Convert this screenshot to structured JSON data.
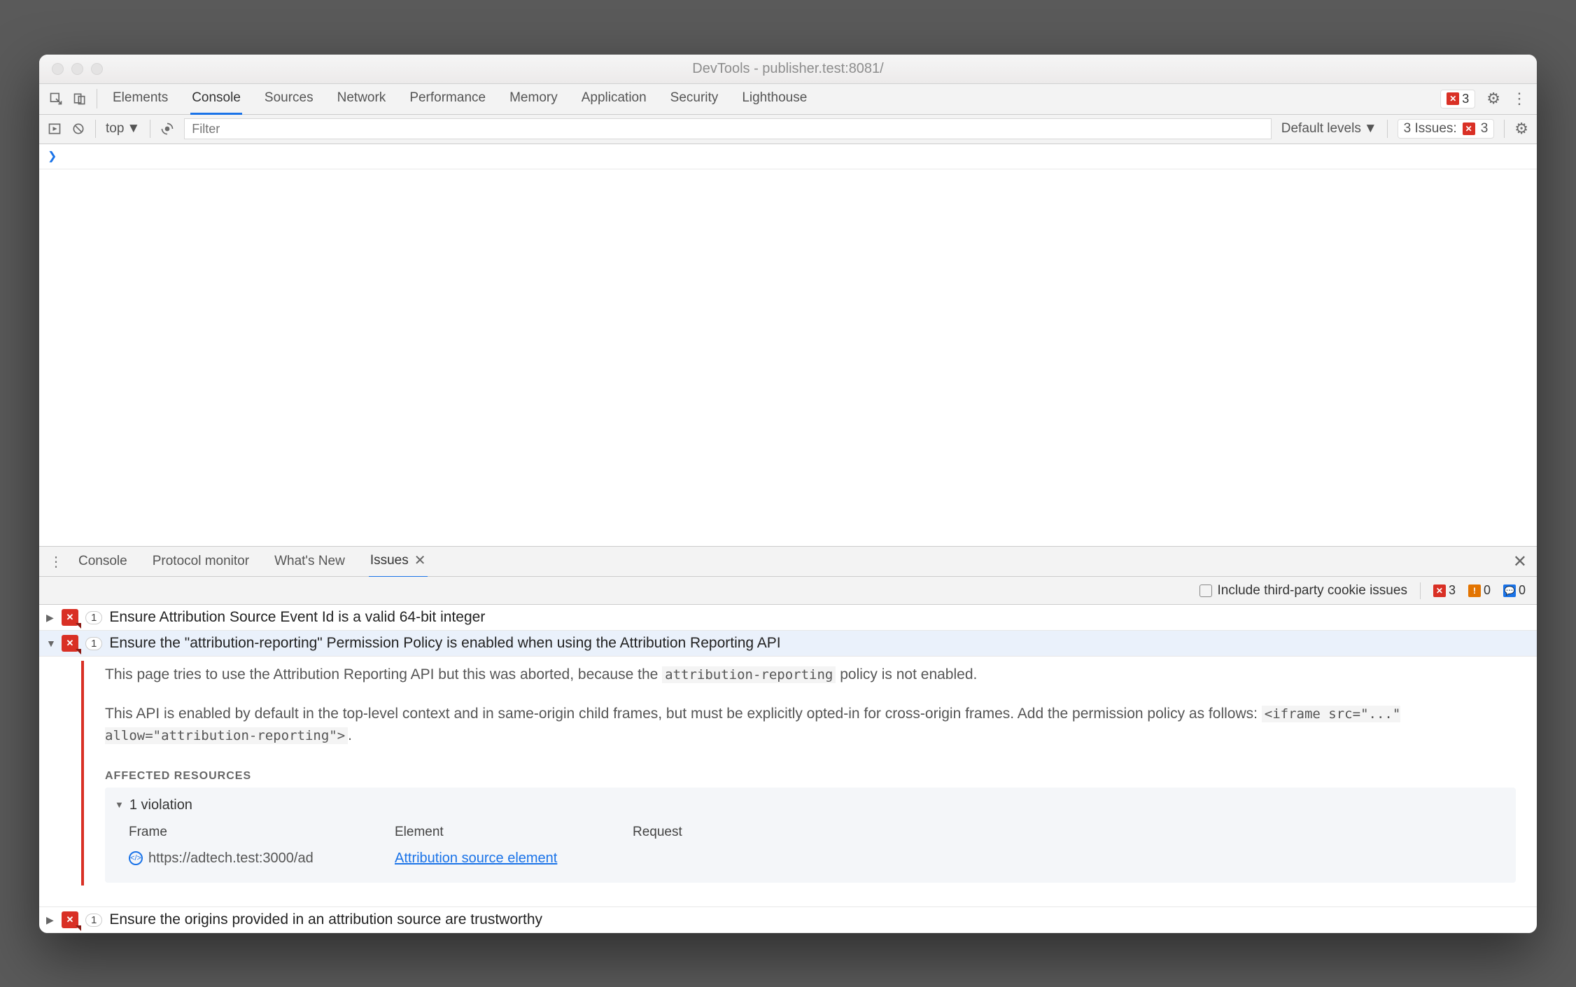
{
  "window": {
    "title": "DevTools - publisher.test:8081/"
  },
  "header_error_count": "3",
  "main_tabs": [
    "Elements",
    "Console",
    "Sources",
    "Network",
    "Performance",
    "Memory",
    "Application",
    "Security",
    "Lighthouse"
  ],
  "main_tabs_active": 1,
  "toolbar": {
    "context": "top",
    "filter_placeholder": "Filter",
    "levels": "Default levels",
    "issues_label": "3 Issues:",
    "issues_count": "3"
  },
  "drawer_tabs": [
    {
      "label": "Console"
    },
    {
      "label": "Protocol monitor"
    },
    {
      "label": "What's New"
    },
    {
      "label": "Issues",
      "active": true,
      "closable": true
    }
  ],
  "issues_filter": {
    "checkbox_label": "Include third-party cookie issues",
    "counts": {
      "error": "3",
      "warning": "0",
      "info": "0"
    }
  },
  "issues": [
    {
      "expanded": false,
      "count": "1",
      "title": "Ensure Attribution Source Event Id is a valid 64-bit integer"
    },
    {
      "expanded": true,
      "count": "1",
      "title": "Ensure the \"attribution-reporting\" Permission Policy is enabled when using the Attribution Reporting API",
      "body": {
        "p1_a": "This page tries to use the Attribution Reporting API but this was aborted, because the ",
        "p1_code": "attribution-reporting",
        "p1_b": " policy is not enabled.",
        "p2_a": "This API is enabled by default in the top-level context and in same-origin child frames, but must be explicitly opted-in for cross-origin frames. Add the permission policy as follows: ",
        "p2_code": "<iframe src=\"...\" allow=\"attribution-reporting\">",
        "p2_b": ".",
        "affected_title": "AFFECTED RESOURCES",
        "violation_label": "1 violation",
        "table": {
          "headers": [
            "Frame",
            "Element",
            "Request"
          ],
          "row": {
            "frame": "https://adtech.test:3000/ad",
            "element": "Attribution source element",
            "request": ""
          }
        }
      }
    },
    {
      "expanded": false,
      "count": "1",
      "title": "Ensure the origins provided in an attribution source are trustworthy"
    }
  ]
}
